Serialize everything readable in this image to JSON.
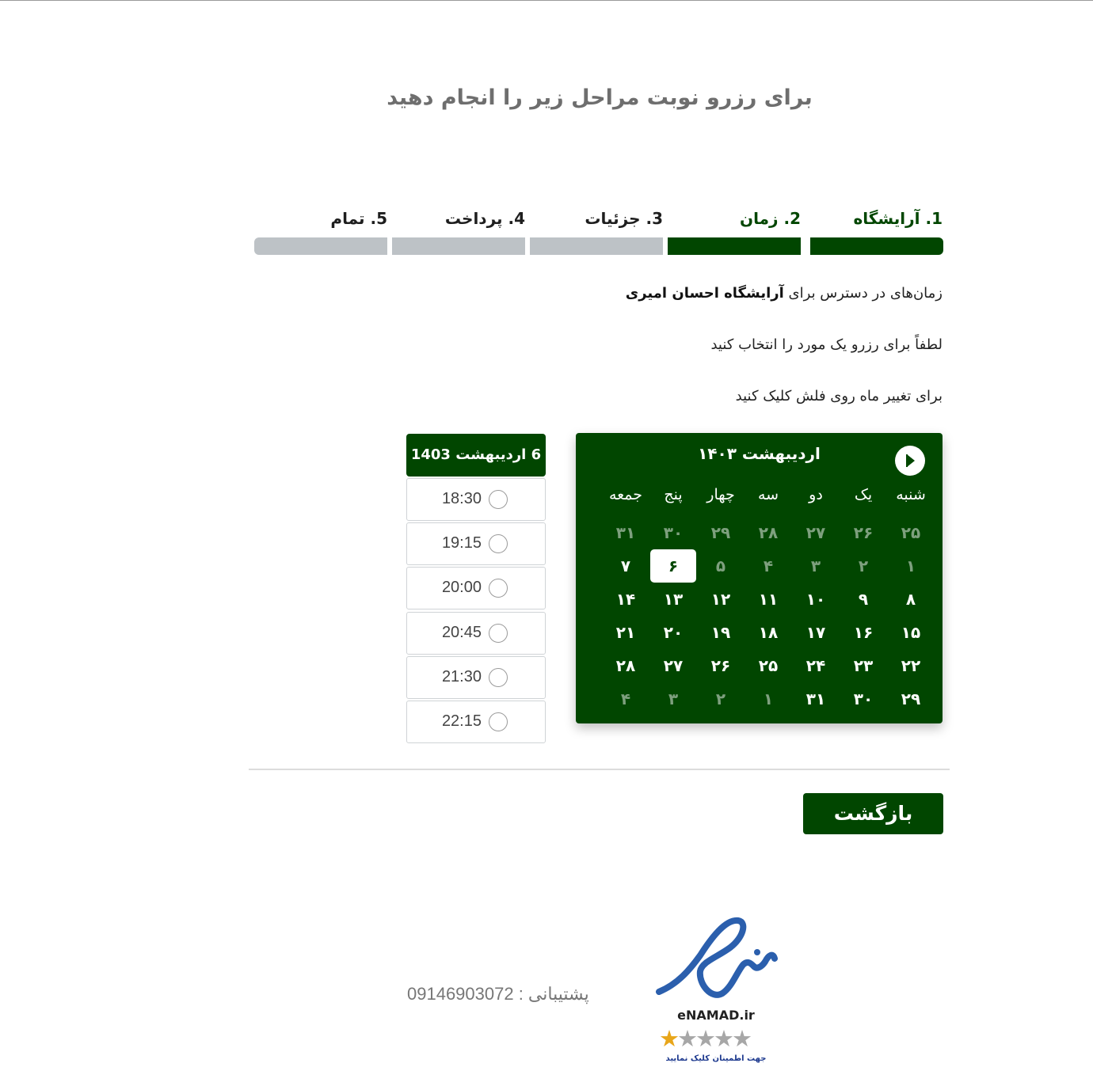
{
  "page_title": "برای رزرو نوبت مراحل زیر را انجام دهید",
  "steps": [
    {
      "label": "1. آرایشگاه",
      "state": "done"
    },
    {
      "label": "2. زمان",
      "state": "active"
    },
    {
      "label": "3. جزئیات",
      "state": "pending"
    },
    {
      "label": "4. پرداخت",
      "state": "pending"
    },
    {
      "label": "5. تمام",
      "state": "pending"
    }
  ],
  "info": {
    "available_prefix": "زمان‌های در دسترس برای",
    "salon_name": "آرایشگاه احسان امیری",
    "select_hint": "لطفاً برای رزرو یک مورد را انتخاب کنید",
    "month_hint": "برای تغییر ماه روی فلش کلیک کنید"
  },
  "calendar": {
    "month_title": "اردیبهشت ۱۴۰۳",
    "next_icon": "chevron-right-circle-icon",
    "weekdays": [
      "شنبه",
      "یک",
      "دو",
      "سه",
      "چهار",
      "پنج",
      "جمعه"
    ],
    "weeks": [
      [
        {
          "d": "۲۵",
          "m": true
        },
        {
          "d": "۲۶",
          "m": true
        },
        {
          "d": "۲۷",
          "m": true
        },
        {
          "d": "۲۸",
          "m": true
        },
        {
          "d": "۲۹",
          "m": true
        },
        {
          "d": "۳۰",
          "m": true
        },
        {
          "d": "۳۱",
          "m": true
        }
      ],
      [
        {
          "d": "۱",
          "m": true
        },
        {
          "d": "۲",
          "m": true
        },
        {
          "d": "۳",
          "m": true
        },
        {
          "d": "۴",
          "m": true
        },
        {
          "d": "۵",
          "m": true
        },
        {
          "d": "۶",
          "m": false,
          "sel": true
        },
        {
          "d": "۷",
          "m": false
        }
      ],
      [
        {
          "d": "۸",
          "m": false
        },
        {
          "d": "۹",
          "m": false
        },
        {
          "d": "۱۰",
          "m": false
        },
        {
          "d": "۱۱",
          "m": false
        },
        {
          "d": "۱۲",
          "m": false
        },
        {
          "d": "۱۳",
          "m": false
        },
        {
          "d": "۱۴",
          "m": false
        }
      ],
      [
        {
          "d": "۱۵",
          "m": false
        },
        {
          "d": "۱۶",
          "m": false
        },
        {
          "d": "۱۷",
          "m": false
        },
        {
          "d": "۱۸",
          "m": false
        },
        {
          "d": "۱۹",
          "m": false
        },
        {
          "d": "۲۰",
          "m": false
        },
        {
          "d": "۲۱",
          "m": false
        }
      ],
      [
        {
          "d": "۲۲",
          "m": false
        },
        {
          "d": "۲۳",
          "m": false
        },
        {
          "d": "۲۴",
          "m": false
        },
        {
          "d": "۲۵",
          "m": false
        },
        {
          "d": "۲۶",
          "m": false
        },
        {
          "d": "۲۷",
          "m": false
        },
        {
          "d": "۲۸",
          "m": false
        }
      ],
      [
        {
          "d": "۲۹",
          "m": false
        },
        {
          "d": "۳۰",
          "m": false
        },
        {
          "d": "۳۱",
          "m": false
        },
        {
          "d": "۱",
          "m": true
        },
        {
          "d": "۲",
          "m": true
        },
        {
          "d": "۳",
          "m": true
        },
        {
          "d": "۴",
          "m": true
        }
      ]
    ]
  },
  "slots": {
    "selected_date": "6 اردیبهشت 1403",
    "times": [
      "18:30",
      "19:15",
      "20:00",
      "20:45",
      "21:30",
      "22:15"
    ]
  },
  "back_button": "بازگشت",
  "support": "پشتیبانی : 09146903072",
  "enamad": {
    "text": "eNAMAD.ir",
    "caption": "جهت اطمینان کلیک نمایید",
    "rating_stars": 1,
    "max_stars": 5
  },
  "colors": {
    "primary": "#014600",
    "inactive_bar": "#bdc2c6",
    "muted_day": "#7ea07e",
    "title_gray": "#6e6e6e"
  }
}
